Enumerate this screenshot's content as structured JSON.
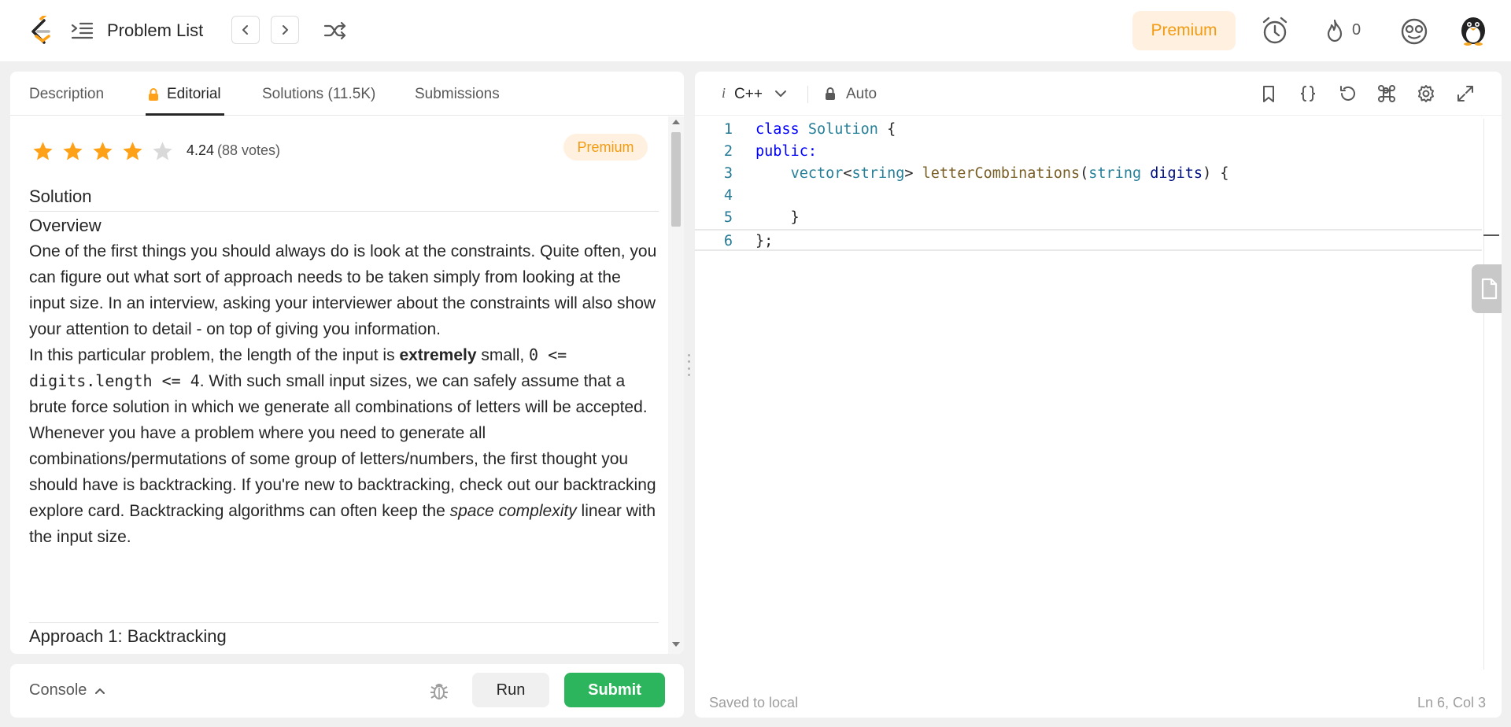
{
  "nav": {
    "problem_list": "Problem List",
    "premium": "Premium",
    "streak": "0"
  },
  "tabs": [
    {
      "label": "Description"
    },
    {
      "label": "Editorial"
    },
    {
      "label": "Solutions (11.5K)"
    },
    {
      "label": "Submissions"
    }
  ],
  "editorial": {
    "rating": "4.24",
    "votes": "(88 votes)",
    "stars_filled": 4,
    "premium_tag": "Premium",
    "heading_solution": "Solution",
    "heading_overview": "Overview",
    "p1": "One of the first things you should always do is look at the constraints. Quite often, you can figure out what sort of approach needs to be taken simply from looking at the input size. In an interview, asking your interviewer about the constraints will also show your attention to detail - on top of giving you information.",
    "p2_a": "In this particular problem, the length of the input is ",
    "p2_bold": "extremely",
    "p2_b": " small, ",
    "p2_code": "0 <= digits.length <= 4",
    "p2_c": ". With such small input sizes, we can safely assume that a brute force solution in which we generate all combinations of letters will be accepted.",
    "p3_a": "Whenever you have a problem where you need to generate all combinations/permutations of some group of letters/numbers, the first thought you should have is backtracking. If you're new to backtracking, check out our backtracking explore card. Backtracking algorithms can often keep the ",
    "p3_italic": "space complexity",
    "p3_b": " linear with the input size.",
    "approach_heading": "Approach 1: Backtracking"
  },
  "console_bar": {
    "console": "Console",
    "run": "Run",
    "submit": "Submit"
  },
  "editor": {
    "language_prefix": "i",
    "language": "C++",
    "mode": "Auto",
    "status_saved": "Saved to local",
    "cursor": "Ln 6, Col 3",
    "lines": [
      {
        "n": "1"
      },
      {
        "n": "2"
      },
      {
        "n": "3"
      },
      {
        "n": "4"
      },
      {
        "n": "5"
      },
      {
        "n": "6"
      }
    ],
    "code": {
      "l1_kw": "class",
      "l1_name": "Solution",
      "l1_rest": " {",
      "l2": "public:",
      "l3_indent": "    ",
      "l3_type": "vector",
      "l3_lt": "<",
      "l3_tparam": "string",
      "l3_gt": "> ",
      "l3_fn": "letterCombinations",
      "l3_open": "(",
      "l3_ptype": "string",
      "l3_sp": " ",
      "l3_pname": "digits",
      "l3_close": ") {",
      "l5": "    }",
      "l6": "};"
    }
  },
  "colors": {
    "accent_premium": "#f39c12",
    "submit_green": "#2db55d",
    "star_gold": "#ffa116"
  }
}
